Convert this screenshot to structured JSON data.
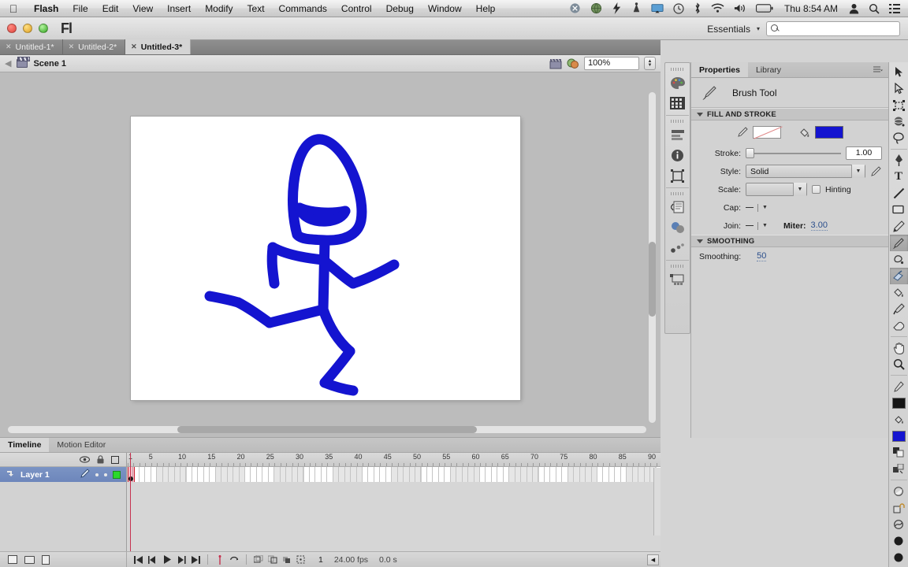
{
  "macbar": {
    "apple_icon": "apple-icon",
    "menus": [
      {
        "label": "Flash",
        "bold": true
      },
      {
        "label": "File",
        "bold": false
      },
      {
        "label": "Edit",
        "bold": false
      },
      {
        "label": "View",
        "bold": false
      },
      {
        "label": "Insert",
        "bold": false
      },
      {
        "label": "Modify",
        "bold": false
      },
      {
        "label": "Text",
        "bold": false
      },
      {
        "label": "Commands",
        "bold": false
      },
      {
        "label": "Control",
        "bold": false
      },
      {
        "label": "Debug",
        "bold": false
      },
      {
        "label": "Window",
        "bold": false
      },
      {
        "label": "Help",
        "bold": false
      }
    ],
    "status_icons": [
      "dropbox-icon",
      "globe-icon",
      "flash-plug-icon",
      "wifi-signal-icon",
      "airplay-icon",
      "clock-history-icon",
      "bluetooth-icon",
      "wifi-icon",
      "volume-icon",
      "battery-icon"
    ],
    "clock": "Thu 8:54 AM",
    "user_icon": "user-icon",
    "spotlight_icon": "search-icon",
    "notification_icon": "list-icon"
  },
  "window": {
    "app_logo": "Fl",
    "workspace": "Essentials",
    "workspace_caret": "▾",
    "search_placeholder": ""
  },
  "doc_tabs": [
    {
      "label": "Untitled-1*",
      "active": false
    },
    {
      "label": "Untitled-2*",
      "active": false
    },
    {
      "label": "Untitled-3*",
      "active": true
    }
  ],
  "scene_bar": {
    "back_arrow": "◀",
    "scene_icon": "clapperboard-icon",
    "scene_label": "Scene 1",
    "edit_scene_icon": "edit-scene-icon",
    "edit_symbol_icon": "edit-symbol-icon",
    "zoom_value": "100%",
    "zoom_stepper": "stepper-icon"
  },
  "stage": {
    "drawing_name": "stick-figure-drawing",
    "stroke_color": "#1414d0",
    "background": "#ffffff"
  },
  "properties": {
    "tabs": [
      {
        "label": "Properties",
        "active": true
      },
      {
        "label": "Library",
        "active": false
      }
    ],
    "panel_menu_icon": "panel-menu-icon",
    "tool_icon": "brush-icon",
    "tool_name": "Brush Tool",
    "fill_stroke": {
      "title": "FILL AND STROKE",
      "stroke_swatch_icon": "pencil-icon",
      "stroke_swatch_value": "none",
      "fill_swatch_icon": "paint-bucket-icon",
      "fill_swatch_color": "#1414d0",
      "stroke_label": "Stroke:",
      "stroke_value": "1.00",
      "style_label": "Style:",
      "style_value": "Solid",
      "style_edit_icon": "pencil-edit-icon",
      "scale_label": "Scale:",
      "scale_value": "",
      "hinting_label": "Hinting",
      "hinting_checked": false,
      "cap_label": "Cap:",
      "cap_value": "—",
      "join_label": "Join:",
      "join_value": "—",
      "miter_label": "Miter:",
      "miter_value": "3.00"
    },
    "smoothing": {
      "title": "SMOOTHING",
      "label": "Smoothing:",
      "value": "50"
    }
  },
  "dock_strip": {
    "items": [
      {
        "name": "color-panel-icon"
      },
      {
        "name": "swatches-panel-icon"
      },
      {
        "name": "align-panel-icon"
      },
      {
        "name": "info-panel-icon"
      },
      {
        "name": "transform-panel-icon"
      },
      {
        "name": "code-snippets-icon"
      },
      {
        "name": "motion-presets-icon"
      },
      {
        "name": "components-icon"
      },
      {
        "name": "movie-explorer-icon"
      }
    ]
  },
  "toolbar": {
    "tools": [
      {
        "name": "selection-tool",
        "glyph": "arrow",
        "selected": false
      },
      {
        "name": "subselection-tool",
        "glyph": "arrow-hollow",
        "selected": false
      },
      {
        "name": "free-transform-tool",
        "glyph": "transform",
        "selected": false
      },
      {
        "name": "3d-rotation-tool",
        "glyph": "sphere",
        "selected": false
      },
      {
        "name": "lasso-tool",
        "glyph": "lasso",
        "selected": false
      },
      {
        "name": "pen-tool",
        "glyph": "pen",
        "selected": false
      },
      {
        "name": "text-tool",
        "glyph": "T",
        "selected": false
      },
      {
        "name": "line-tool",
        "glyph": "line",
        "selected": false
      },
      {
        "name": "rectangle-tool",
        "glyph": "rect",
        "selected": false
      },
      {
        "name": "pencil-tool",
        "glyph": "pencil",
        "selected": false
      },
      {
        "name": "brush-tool",
        "glyph": "brush",
        "selected": true
      },
      {
        "name": "deco-tool",
        "glyph": "deco",
        "selected": false
      },
      {
        "name": "bone-tool",
        "glyph": "bone",
        "selected": true
      },
      {
        "name": "paint-bucket-tool",
        "glyph": "bucket",
        "selected": false
      },
      {
        "name": "eyedropper-tool",
        "glyph": "dropper",
        "selected": false
      },
      {
        "name": "eraser-tool",
        "glyph": "eraser",
        "selected": false
      },
      {
        "name": "hand-tool",
        "glyph": "hand",
        "selected": false
      },
      {
        "name": "zoom-tool",
        "glyph": "magnifier",
        "selected": false
      }
    ],
    "colors": {
      "stroke_icon": "stroke-pencil-icon",
      "stroke_color": "#151515",
      "fill_icon": "fill-bucket-icon",
      "fill_color": "#1414d0"
    },
    "options": [
      "black-white-icon",
      "swap-colors-icon",
      "brush-size-icon",
      "lock-fill-icon",
      "smoothing-option-icon",
      "brush-mode-icon",
      "brush-shape-icon"
    ]
  },
  "timeline": {
    "tabs": [
      {
        "label": "Timeline",
        "active": true
      },
      {
        "label": "Motion Editor",
        "active": false
      }
    ],
    "header_icons": [
      "eye-icon",
      "lock-icon",
      "outline-icon"
    ],
    "ruler_ticks": [
      1,
      5,
      10,
      15,
      20,
      25,
      30,
      35,
      40,
      45,
      50,
      55,
      60,
      65,
      70,
      75,
      80,
      85,
      90
    ],
    "layers": [
      {
        "name": "Layer 1",
        "active": true,
        "pencil_icon": "pencil-icon",
        "visible_dot": "•",
        "lock_dot": "•",
        "outline_color": "#2bd82b"
      }
    ],
    "current_frame_marker": 1,
    "footer": {
      "new_layer_icon": "new-layer-icon",
      "new_folder_icon": "new-folder-icon",
      "delete_icon": "delete-layer-icon",
      "playback": [
        "first-frame-icon",
        "prev-frame-icon",
        "play-icon",
        "next-frame-icon",
        "last-frame-icon"
      ],
      "onion_skin_icons": [
        "onion-skin-icon",
        "loop-icon",
        "edit-multiple-frames-icon",
        "modify-markers-icon",
        "center-frame-icon",
        "onion-outline-icon"
      ],
      "current_frame": "1",
      "fps": "24.00 fps",
      "elapsed": "0.0 s",
      "resize_icon": "resize-handle-icon"
    }
  }
}
